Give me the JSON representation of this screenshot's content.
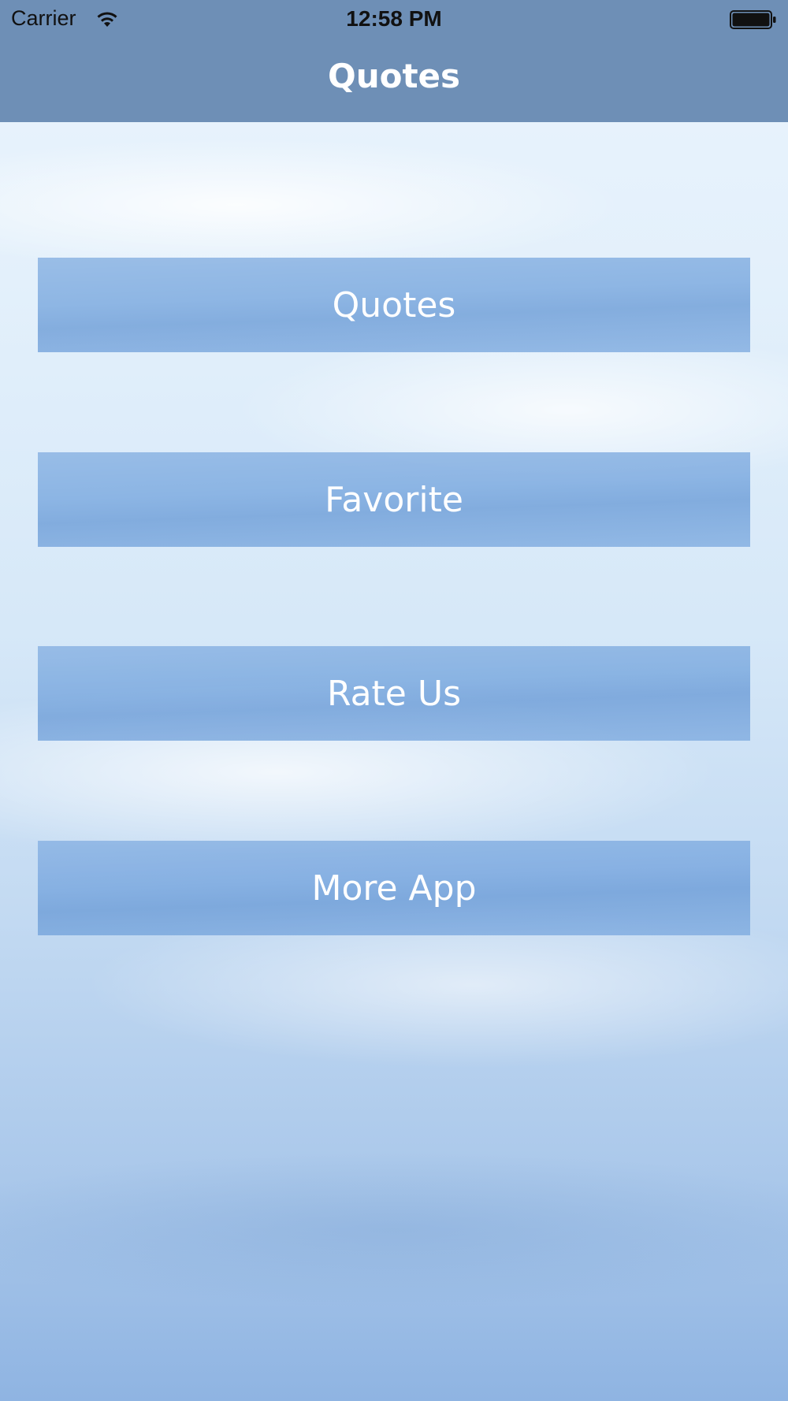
{
  "status_bar": {
    "carrier": "Carrier",
    "time": "12:58 PM",
    "wifi_icon": "wifi-icon",
    "battery_icon": "battery-icon"
  },
  "nav_bar": {
    "title": "Quotes",
    "color": "#6e8fb6"
  },
  "menu": {
    "items": [
      {
        "label": "Quotes"
      },
      {
        "label": "Favorite"
      },
      {
        "label": "Rate Us"
      },
      {
        "label": "More App"
      }
    ]
  },
  "colors": {
    "button_fill": "#76a5de",
    "button_text": "#ffffff",
    "nav_title": "#ffffff"
  }
}
